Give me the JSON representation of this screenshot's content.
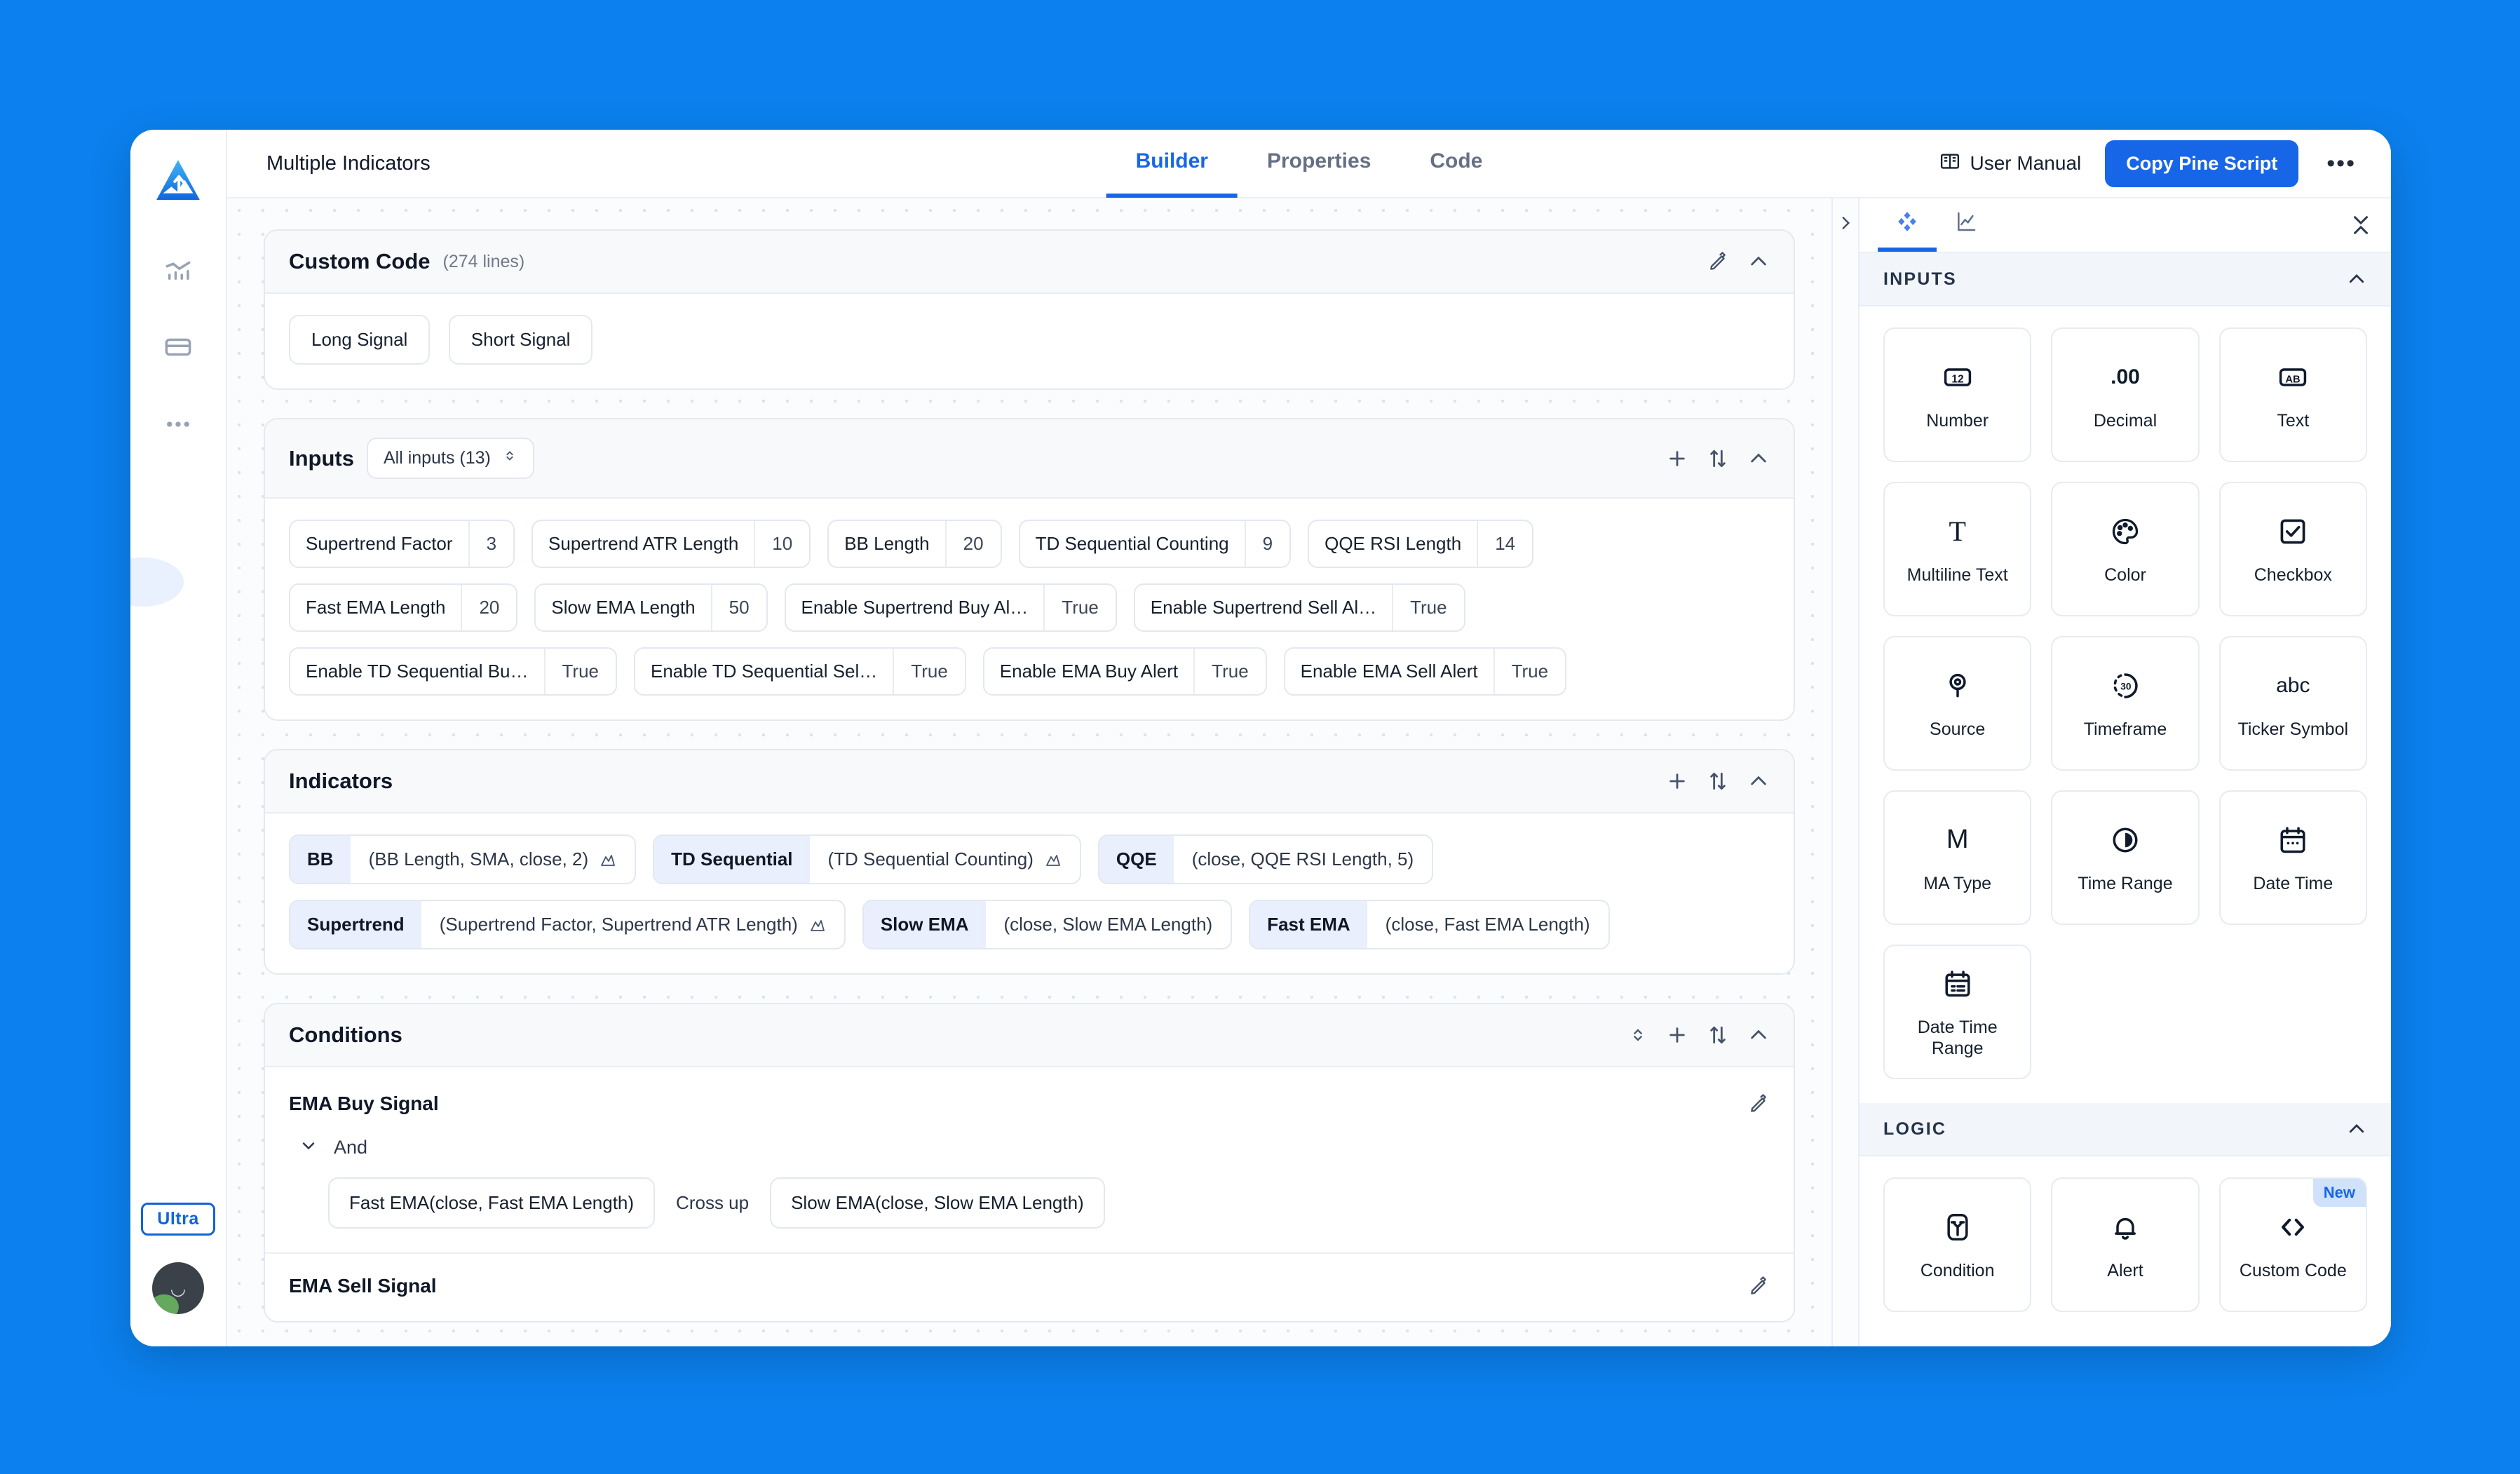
{
  "sidebar": {
    "logo_icon": "mountain-logo-icon",
    "items": [
      {
        "icon": "chart-bars-icon",
        "name": "sidebar-item-charts"
      },
      {
        "icon": "card-icon",
        "name": "sidebar-item-billing"
      },
      {
        "icon": "more-dots-icon",
        "name": "sidebar-item-more"
      }
    ],
    "plan_badge": "Ultra",
    "avatar_icon": "user-avatar-icon"
  },
  "topbar": {
    "doc_title": "Multiple Indicators",
    "tabs": [
      {
        "label": "Builder",
        "active": true
      },
      {
        "label": "Properties",
        "active": false
      },
      {
        "label": "Code",
        "active": false
      }
    ],
    "manual_label": "User Manual",
    "manual_icon": "book-icon",
    "copy_button": "Copy Pine Script",
    "kebab_icon": "more-horizontal-icon",
    "accent_color": "#1766e8"
  },
  "custom_code": {
    "title": "Custom Code",
    "subtitle": "(274 lines)",
    "edit_icon": "pencil-icon",
    "collapse_icon": "chevron-up-icon",
    "buttons": [
      "Long Signal",
      "Short Signal"
    ]
  },
  "inputs_section": {
    "title": "Inputs",
    "filter_label": "All inputs (13)",
    "filter_icon": "chevron-updown-icon",
    "add_icon": "plus-icon",
    "sort_icon": "sort-icon",
    "collapse_icon": "chevron-up-icon",
    "chips": [
      {
        "key": "Supertrend Factor",
        "value": "3"
      },
      {
        "key": "Supertrend ATR Length",
        "value": "10"
      },
      {
        "key": "BB Length",
        "value": "20"
      },
      {
        "key": "TD Sequential Counting",
        "value": "9"
      },
      {
        "key": "QQE RSI Length",
        "value": "14"
      },
      {
        "key": "Fast EMA Length",
        "value": "20"
      },
      {
        "key": "Slow EMA Length",
        "value": "50"
      },
      {
        "key": "Enable Supertrend Buy Al…",
        "value": "True"
      },
      {
        "key": "Enable Supertrend Sell Al…",
        "value": "True"
      },
      {
        "key": "Enable TD Sequential Bu…",
        "value": "True"
      },
      {
        "key": "Enable TD Sequential Sel…",
        "value": "True"
      },
      {
        "key": "Enable EMA Buy Alert",
        "value": "True"
      },
      {
        "key": "Enable EMA Sell Alert",
        "value": "True"
      }
    ]
  },
  "indicators_section": {
    "title": "Indicators",
    "add_icon": "plus-icon",
    "sort_icon": "sort-icon",
    "collapse_icon": "chevron-up-icon",
    "chips": [
      {
        "name": "BB",
        "args": "(BB Length, SMA, close, 2)",
        "plot": true
      },
      {
        "name": "TD Sequential",
        "args": "(TD Sequential Counting)",
        "plot": true
      },
      {
        "name": "QQE",
        "args": "(close, QQE RSI Length, 5)",
        "plot": false
      },
      {
        "name": "Supertrend",
        "args": "(Supertrend Factor, Supertrend ATR Length)",
        "plot": true
      },
      {
        "name": "Slow EMA",
        "args": "(close, Slow EMA Length)",
        "plot": false
      },
      {
        "name": "Fast EMA",
        "args": "(close, Fast EMA Length)",
        "plot": false
      }
    ]
  },
  "conditions_section": {
    "title": "Conditions",
    "expand_icon": "chevron-updown-icon",
    "add_icon": "plus-icon",
    "sort_icon": "sort-icon",
    "collapse_icon": "chevron-up-icon",
    "groups": [
      {
        "name": "EMA Buy Signal",
        "edit_icon": "pencil-icon",
        "operator": "And",
        "operator_icon": "chevron-down-icon",
        "rows": [
          {
            "left": "Fast EMA(close, Fast EMA Length)",
            "op": "Cross up",
            "right": "Slow EMA(close, Slow EMA Length)"
          }
        ]
      },
      {
        "name": "EMA Sell Signal",
        "edit_icon": "pencil-icon",
        "operator": "",
        "operator_icon": "",
        "rows": []
      }
    ]
  },
  "right_panel": {
    "tabs": [
      {
        "icon": "blocks-icon",
        "active": true
      },
      {
        "icon": "chart-line-icon",
        "active": false
      }
    ],
    "collapse_icon": "chevrons-collapse-icon",
    "sections": [
      {
        "title": "INPUTS",
        "collapse_icon": "chevron-up-icon",
        "items": [
          {
            "label": "Number",
            "icon": "number-12-icon",
            "glyph": "12",
            "badge": ""
          },
          {
            "label": "Decimal",
            "icon": "decimal-icon",
            "glyph": ".00",
            "badge": ""
          },
          {
            "label": "Text",
            "icon": "text-ab-icon",
            "glyph": "AB",
            "badge": ""
          },
          {
            "label": "Multiline Text",
            "icon": "multiline-text-icon",
            "glyph": "T",
            "badge": ""
          },
          {
            "label": "Color",
            "icon": "color-palette-icon",
            "glyph": "",
            "badge": ""
          },
          {
            "label": "Checkbox",
            "icon": "checkbox-icon",
            "glyph": "",
            "badge": ""
          },
          {
            "label": "Source",
            "icon": "source-pin-icon",
            "glyph": "",
            "badge": ""
          },
          {
            "label": "Timeframe",
            "icon": "timeframe-30-icon",
            "glyph": "30",
            "badge": ""
          },
          {
            "label": "Ticker Symbol",
            "icon": "ticker-abc-icon",
            "glyph": "abc",
            "badge": ""
          },
          {
            "label": "MA Type",
            "icon": "ma-type-m-icon",
            "glyph": "M",
            "badge": ""
          },
          {
            "label": "Time Range",
            "icon": "time-range-clock-icon",
            "glyph": "",
            "badge": ""
          },
          {
            "label": "Date Time",
            "icon": "calendar-icon",
            "glyph": "",
            "badge": ""
          },
          {
            "label": "Date Time Range",
            "icon": "calendar-range-icon",
            "glyph": "",
            "badge": ""
          }
        ]
      },
      {
        "title": "LOGIC",
        "collapse_icon": "chevron-up-icon",
        "items": [
          {
            "label": "Condition",
            "icon": "condition-branch-icon",
            "glyph": "",
            "badge": ""
          },
          {
            "label": "Alert",
            "icon": "bell-icon",
            "glyph": "",
            "badge": ""
          },
          {
            "label": "Custom Code",
            "icon": "code-brackets-icon",
            "glyph": "",
            "badge": "New"
          }
        ]
      }
    ]
  }
}
